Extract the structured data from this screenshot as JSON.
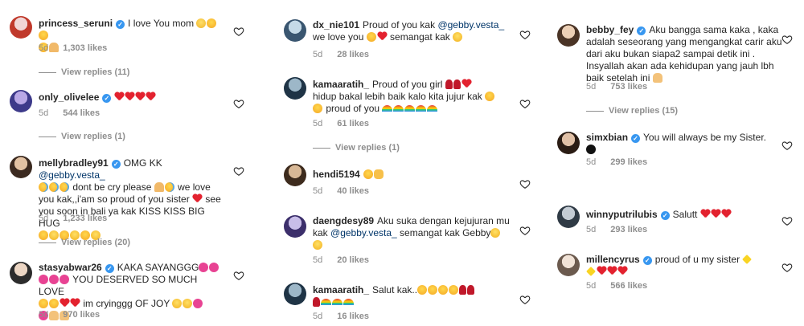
{
  "columns": [
    {
      "comments": [
        {
          "user": "princess_seruni",
          "verified": true,
          "text": "I love You mom",
          "emojis": [
            "sweat",
            "kiss",
            "kiss",
            "pray"
          ],
          "time": "5d",
          "likes": "1,303 likes",
          "replies": "View replies (11)",
          "avatar_colors": [
            "#e9c9c9",
            "#c0392b"
          ]
        },
        {
          "user": "only_olivelee",
          "verified": true,
          "text": "",
          "emojis": [
            "rh",
            "rh",
            "rh",
            "rh"
          ],
          "time": "5d",
          "likes": "544 likes",
          "replies": "View replies (1)",
          "avatar_colors": [
            "#7b68c2",
            "#2b2d6e"
          ]
        },
        {
          "user": "mellybradley91",
          "verified": true,
          "text_parts": [
            "OMG KK ",
            "@gebby.vesta_",
            " dont be cry please",
            " we love you kak,,i'am so proud of you sister",
            " see you soon in bali ya kak KISS KISS BIG HUG"
          ],
          "time": "5d",
          "likes": "1,233 likes",
          "replies": "View replies (20)",
          "avatar_colors": [
            "#c9a27e",
            "#3b2a20"
          ]
        },
        {
          "user": "stasyabwar26",
          "verified": true,
          "text_parts": [
            "KAKA SAYANGGG",
            " YOU DESERVED SO MUCH LOVE",
            " im cryinggg OF JOY"
          ],
          "time": "5d",
          "likes": "970 likes",
          "avatar_colors": [
            "#d8c3b0",
            "#2c2c2c"
          ]
        }
      ]
    },
    {
      "comments": [
        {
          "user": "dx_nie101",
          "verified": false,
          "text_parts": [
            "Proud of you kak ",
            "@gebby.vesta_",
            " we love you",
            " semangat kak"
          ],
          "time": "5d",
          "likes": "28 likes",
          "avatar_colors": [
            "#a9c4d6",
            "#3a5670"
          ]
        },
        {
          "user": "kamaaratih_",
          "verified": false,
          "text_parts": [
            "Proud of you girl",
            " hidup bakal lebih baik kalo kita jujur kak",
            " proud of you"
          ],
          "time": "5d",
          "likes": "61 likes",
          "replies": "View replies (1)",
          "avatar_colors": [
            "#6f8fa3",
            "#1f3446"
          ]
        },
        {
          "user": "hendi5194",
          "verified": false,
          "text": "",
          "time": "5d",
          "likes": "40 likes",
          "avatar_colors": [
            "#b5936e",
            "#3d2b1d"
          ]
        },
        {
          "user": "daengdesy89",
          "verified": false,
          "text_parts": [
            "Aku suka dengan kejujuran mu kak ",
            "@gebby.vesta_",
            "  semangat kak Gebby"
          ],
          "time": "5d",
          "likes": "20 likes",
          "avatar_colors": [
            "#8e7cc3",
            "#3c2f6b"
          ]
        },
        {
          "user": "kamaaratih_",
          "verified": false,
          "text": "Salut kak..",
          "time": "5d",
          "likes": "16 likes",
          "avatar_colors": [
            "#6f8fa3",
            "#1f3446"
          ]
        }
      ]
    },
    {
      "comments": [
        {
          "user": "bebby_fey",
          "verified": true,
          "text": "Aku bangga sama kaka , kaka adalah seseorang yang mengangkat carir aku dari aku bukan siapa2 sampai detik ini . Insyallah akan ada kehidupan yang jauh lbh baik setelah ini",
          "time": "5d",
          "likes": "753 likes",
          "replies": "View replies (15)",
          "avatar_colors": [
            "#d9b99b",
            "#4a3426"
          ]
        },
        {
          "user": "simxbian",
          "verified": true,
          "text": "You will always be my Sister.",
          "time": "5d",
          "likes": "299 likes",
          "avatar_colors": [
            "#c7a48a",
            "#2a1c14"
          ]
        },
        {
          "user": "winnyputrilubis",
          "verified": true,
          "text": "Salutt",
          "time": "5d",
          "likes": "293 likes",
          "avatar_colors": [
            "#9aa6b2",
            "#2f3a45"
          ]
        },
        {
          "user": "millencyrus",
          "verified": true,
          "text": "proud of u my sister",
          "time": "5d",
          "likes": "566 likes",
          "avatar_colors": [
            "#e6d3c4",
            "#6b5a4e"
          ]
        }
      ]
    }
  ]
}
